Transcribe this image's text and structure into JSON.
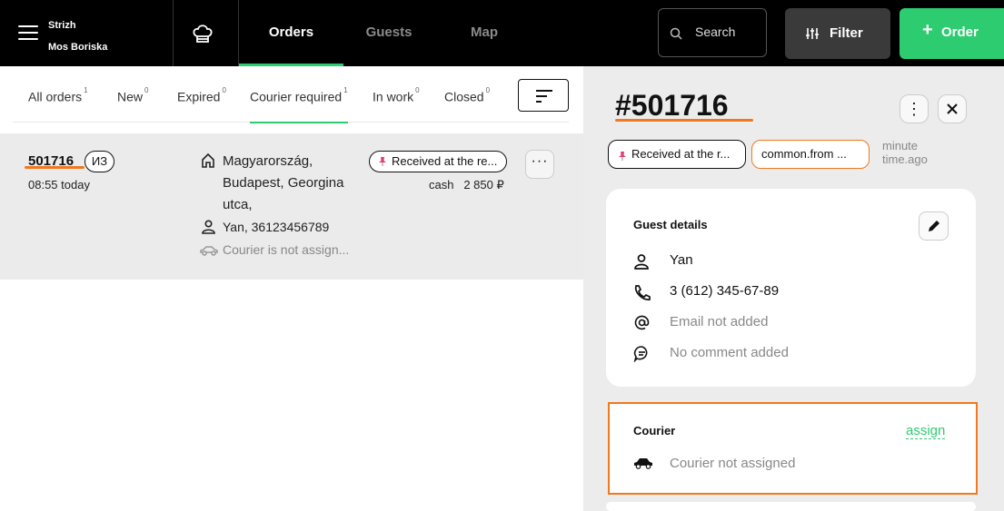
{
  "header": {
    "brand_line1": "Strizh",
    "brand_line2": "Mos Boriska",
    "tabs": [
      {
        "label": "Orders",
        "active": true
      },
      {
        "label": "Guests",
        "active": false
      },
      {
        "label": "Map",
        "active": false
      }
    ],
    "search_placeholder": "Search",
    "filter_label": "Filter",
    "order_label": "Order",
    "order_plus": "+"
  },
  "filters": {
    "tabs": [
      {
        "label": "All orders",
        "count": "1"
      },
      {
        "label": "New",
        "count": "0"
      },
      {
        "label": "Expired",
        "count": "0"
      },
      {
        "label": "Courier required",
        "count": "1",
        "active": true
      },
      {
        "label": "In work",
        "count": "0"
      },
      {
        "label": "Closed",
        "count": "0"
      }
    ]
  },
  "order": {
    "number": "501716",
    "tag": "ИЗ",
    "time": "08:55 today",
    "address": "Magyarország, Budapest, Georgina utca,",
    "guest": "Yan, 36123456789",
    "courier": "Courier is not assign...",
    "status": "Received at the re...",
    "payment_method": "cash",
    "amount": "2 850 ₽",
    "more": "···"
  },
  "detail": {
    "number": "#501716",
    "status_chip": "Received at the r...",
    "source_chip": "common.from ...",
    "time_ago": "minute time.ago",
    "guest_title": "Guest details",
    "guest_name": "Yan",
    "phone": "3 (612) 345-67-89",
    "email": "Email not added",
    "comment": "No comment added",
    "courier_title": "Courier",
    "assign_label": "assign",
    "courier_status": "Courier not assigned"
  },
  "colors": {
    "accent_green": "#2ecc71",
    "highlight_orange": "#f0781e",
    "topbar": "#000000"
  }
}
